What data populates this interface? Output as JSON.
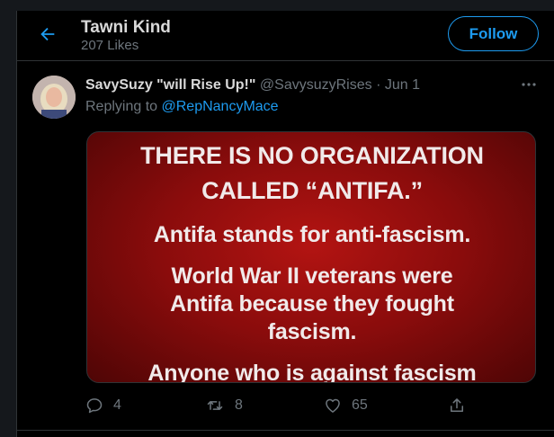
{
  "header": {
    "title": "Tawni Kind",
    "subtitle": "207 Likes",
    "follow_label": "Follow"
  },
  "tweet": {
    "display_name": "SavySuzy \"will Rise Up!\"",
    "meta": " @SavysuzyRises · Jun 1",
    "replying_prefix": "Replying to ",
    "replying_handle": "@RepNancyMace",
    "image_text": [
      "THERE IS NO ORGANIZATION",
      "CALLED “ANTIFA.”",
      "Antifa stands for anti-fascism.",
      "World War II veterans were",
      "Antifa because they fought",
      "fascism.",
      "Anyone who is against fascism"
    ],
    "actions": {
      "replies": "4",
      "retweets": "8",
      "likes": "65"
    }
  },
  "colors": {
    "accent": "#1d9bf0",
    "background": "#000000",
    "muted_text": "#6e767d",
    "image_red": "#b31412"
  },
  "icons": [
    "back-arrow-icon",
    "more-icon",
    "reply-icon",
    "retweet-icon",
    "like-icon",
    "share-icon"
  ]
}
